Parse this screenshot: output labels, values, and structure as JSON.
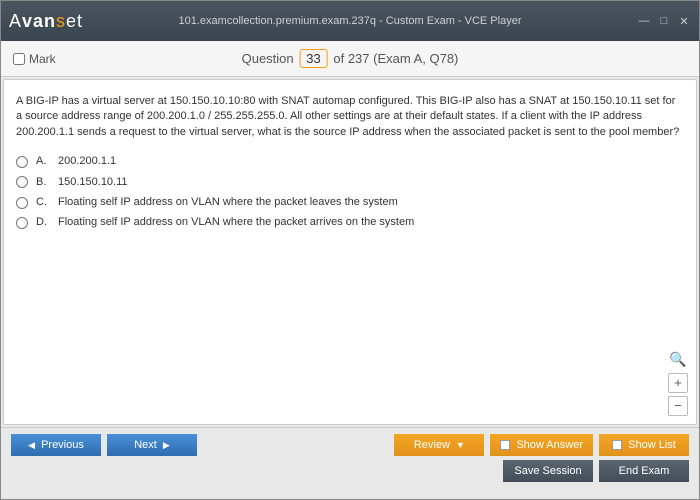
{
  "titlebar": {
    "title": "101.examcollection.premium.exam.237q - Custom Exam - VCE Player"
  },
  "header": {
    "mark_label": "Mark",
    "question_word": "Question",
    "current": "33",
    "total_phrase": " of 237 (Exam A, Q78)"
  },
  "question": {
    "text": "A BIG-IP has a virtual server at 150.150.10.10:80 with SNAT automap configured. This BIG-IP also has a SNAT at 150.150.10.11 set for a source address range of 200.200.1.0 / 255.255.255.0. All other settings are at their default states. If a client with the IP address 200.200.1.1 sends a request to the virtual server, what is the source IP address when the associated packet is sent to the pool member?",
    "options": [
      {
        "label": "A.",
        "text": "200.200.1.1"
      },
      {
        "label": "B.",
        "text": "150.150.10.11"
      },
      {
        "label": "C.",
        "text": "Floating self IP address on VLAN where the packet leaves the system"
      },
      {
        "label": "D.",
        "text": "Floating self IP address on VLAN where the packet arrives on the system"
      }
    ]
  },
  "footer": {
    "previous": "Previous",
    "next": "Next",
    "review": "Review",
    "show_answer": "Show Answer",
    "show_list": "Show List",
    "save_session": "Save Session",
    "end_exam": "End Exam"
  }
}
